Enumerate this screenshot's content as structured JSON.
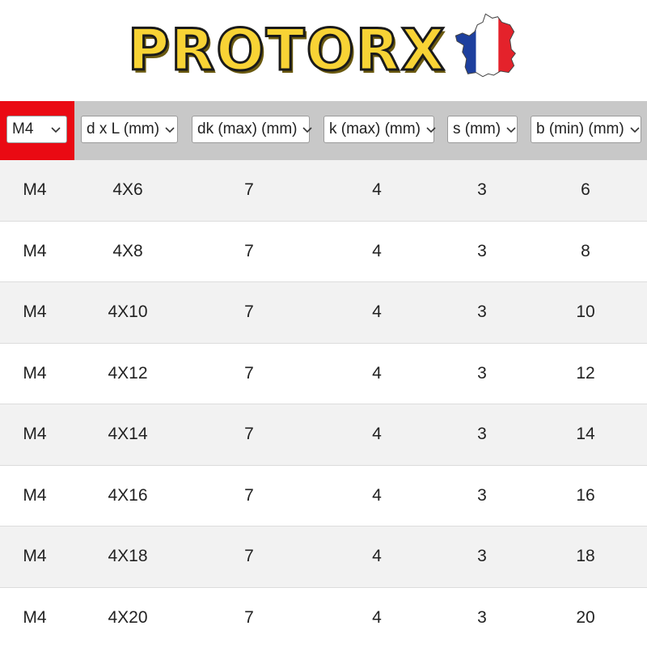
{
  "logo": {
    "text": "PROTORX",
    "color": "#f8d335",
    "flag_colors": [
      "#1d3f9e",
      "#ffffff",
      "#e4222b"
    ]
  },
  "header": {
    "active_color": "#ea0a13",
    "filters": [
      {
        "label": "M4"
      },
      {
        "label": "d x L (mm)"
      },
      {
        "label": "dk (max) (mm)"
      },
      {
        "label": "k (max) (mm)"
      },
      {
        "label": "s (mm)"
      },
      {
        "label": "b (min) (mm)"
      }
    ]
  },
  "table": {
    "rows": [
      {
        "size": "M4",
        "dxl": "4X6",
        "dk": "7",
        "k": "4",
        "s": "3",
        "b": "6"
      },
      {
        "size": "M4",
        "dxl": "4X8",
        "dk": "7",
        "k": "4",
        "s": "3",
        "b": "8"
      },
      {
        "size": "M4",
        "dxl": "4X10",
        "dk": "7",
        "k": "4",
        "s": "3",
        "b": "10"
      },
      {
        "size": "M4",
        "dxl": "4X12",
        "dk": "7",
        "k": "4",
        "s": "3",
        "b": "12"
      },
      {
        "size": "M4",
        "dxl": "4X14",
        "dk": "7",
        "k": "4",
        "s": "3",
        "b": "14"
      },
      {
        "size": "M4",
        "dxl": "4X16",
        "dk": "7",
        "k": "4",
        "s": "3",
        "b": "16"
      },
      {
        "size": "M4",
        "dxl": "4X18",
        "dk": "7",
        "k": "4",
        "s": "3",
        "b": "18"
      },
      {
        "size": "M4",
        "dxl": "4X20",
        "dk": "7",
        "k": "4",
        "s": "3",
        "b": "20"
      }
    ]
  }
}
